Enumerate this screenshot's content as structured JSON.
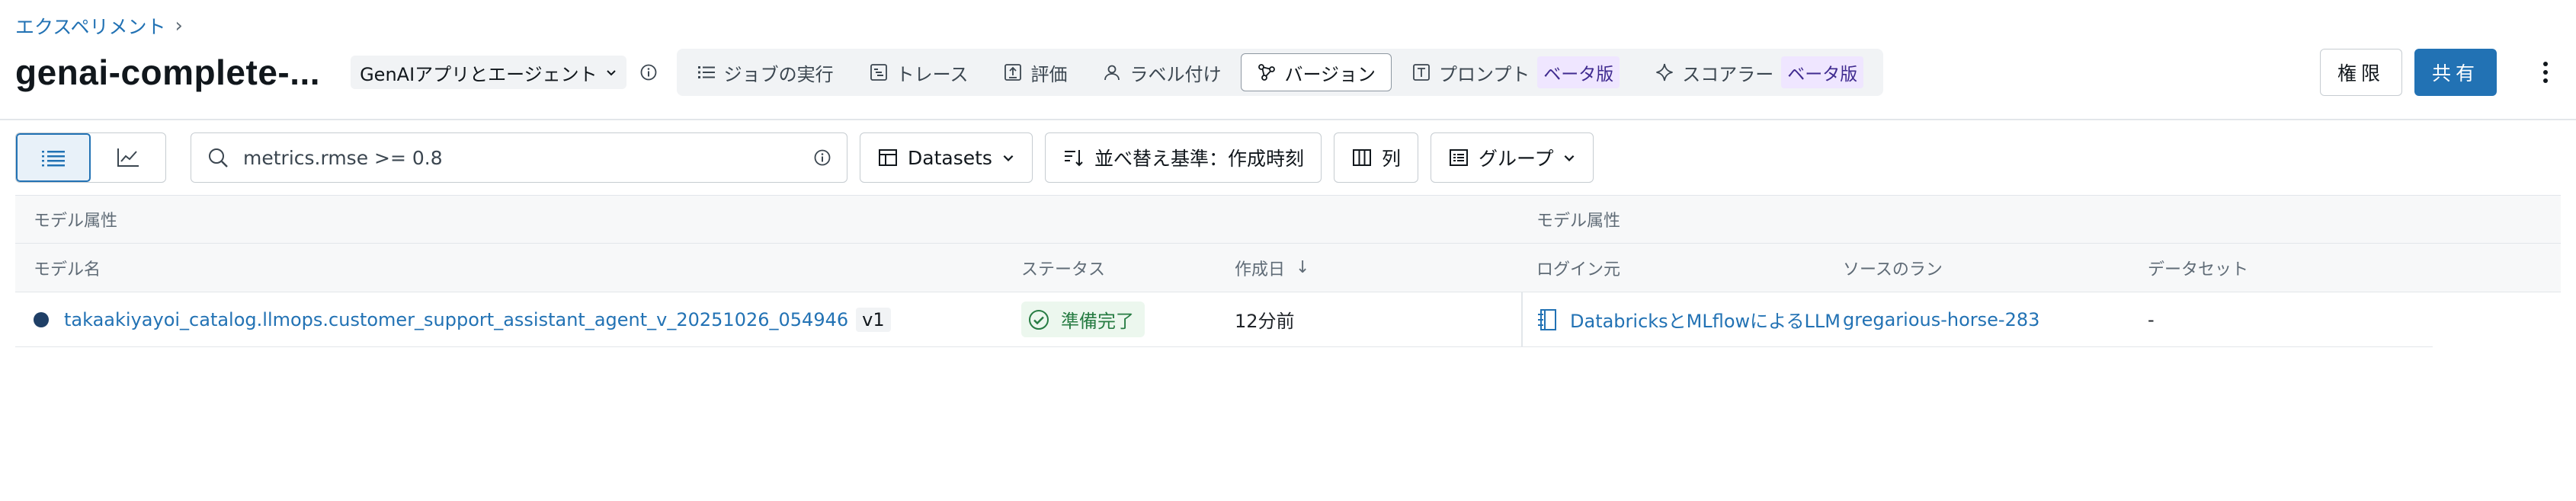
{
  "breadcrumb": {
    "root": "エクスペリメント"
  },
  "header": {
    "title": "genai-complete-...",
    "app_type": "GenAIアプリとエージェント",
    "tabs": [
      {
        "label": "ジョブの実行",
        "icon": "list-icon"
      },
      {
        "label": "トレース",
        "icon": "trace-icon"
      },
      {
        "label": "評価",
        "icon": "evaluation-icon"
      },
      {
        "label": "ラベル付け",
        "icon": "user-icon"
      },
      {
        "label": "バージョン",
        "icon": "versions-icon",
        "active": true
      },
      {
        "label": "プロンプト",
        "icon": "prompt-icon",
        "badge": "ベータ版"
      },
      {
        "label": "スコアラー",
        "icon": "sparkle-icon",
        "badge": "ベータ版"
      }
    ],
    "permissions_label": "権限",
    "share_label": "共有"
  },
  "toolbar": {
    "search_value": "metrics.rmse >= 0.8",
    "datasets_label": "Datasets",
    "sort_label": "並べ替え基準：作成時刻",
    "columns_label": "列",
    "group_label": "グループ"
  },
  "table": {
    "group_left": "モデル属性",
    "group_right": "モデル属性",
    "columns": [
      "モデル名",
      "ステータス",
      "作成日",
      "ログイン元",
      "ソースのラン",
      "データセット"
    ],
    "rows": [
      {
        "model_name": "takaakiyayoi_catalog.llmops.customer_support_assistant_agent_v_20251026_054946",
        "version": "v1",
        "status": "準備完了",
        "created": "12分前",
        "logged_from": "DatabricksとMLflowによるLLM",
        "source_run": "gregarious-horse-283",
        "dataset": "-"
      }
    ]
  },
  "colors": {
    "accent": "#2272b4",
    "status_green": "#277c43",
    "beta_bg": "#efe6ff"
  }
}
